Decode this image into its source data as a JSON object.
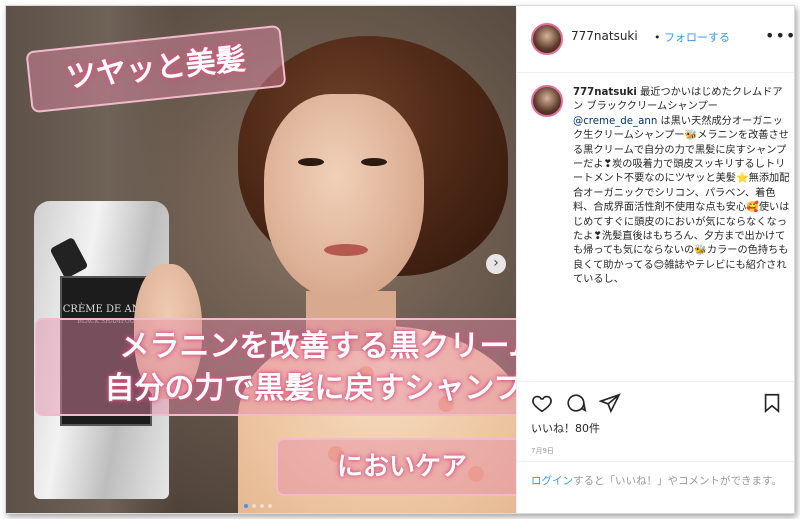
{
  "post": {
    "overlay_top": "ツヤッと美髪",
    "overlay_mid_line1": "メラニンを改善する黒クリーム",
    "overlay_mid_line2": "自分の力で黒髪に戻すシャンプー",
    "overlay_bottom": "においケア",
    "product_label_brand": "CRÈME DE ANN",
    "product_label_name": "BLACK SHAMPOO",
    "next_arrow": "›"
  },
  "header": {
    "username": "777natsuki",
    "separator": "•",
    "follow_label": "フォローする",
    "more_icon": "more-icon"
  },
  "caption": {
    "username": "777natsuki",
    "text_1": " 最近つかいはじめたクレムドアン ブラッククリームシャンプー ",
    "mention": "@creme_de_ann",
    "text_2": " は黒い天然成分オーガニック生クリームシャンプー🐝メラニンを改善させる黒クリームで自分の力で黒髪に戻すシャンプーだよ❣炭の吸着力で頭皮スッキリするしトリートメント不要なのにツヤッと美髪⭐無添加配合オーガニックでシリコン、パラベン、着色料、合成界面活性剤不使用な点も安心🥰使いはじめてすぐに頭皮のにおいが気にならなくなったよ❣洗髪直後はもちろん、夕方まで出かけても帰っても気にならないの🐝カラーの色持ちも良くて助かってる😊雑誌やテレビにも紹介されているし、"
  },
  "actions": {
    "likes": "いいね！80件",
    "date": "7月9日"
  },
  "footer": {
    "login": "ログイン",
    "text": "すると「いいね！」やコメントができます。"
  },
  "colors": {
    "link": "#3897f0",
    "banner_glow": "#d9547f",
    "story_ring": "#e36f9f"
  }
}
